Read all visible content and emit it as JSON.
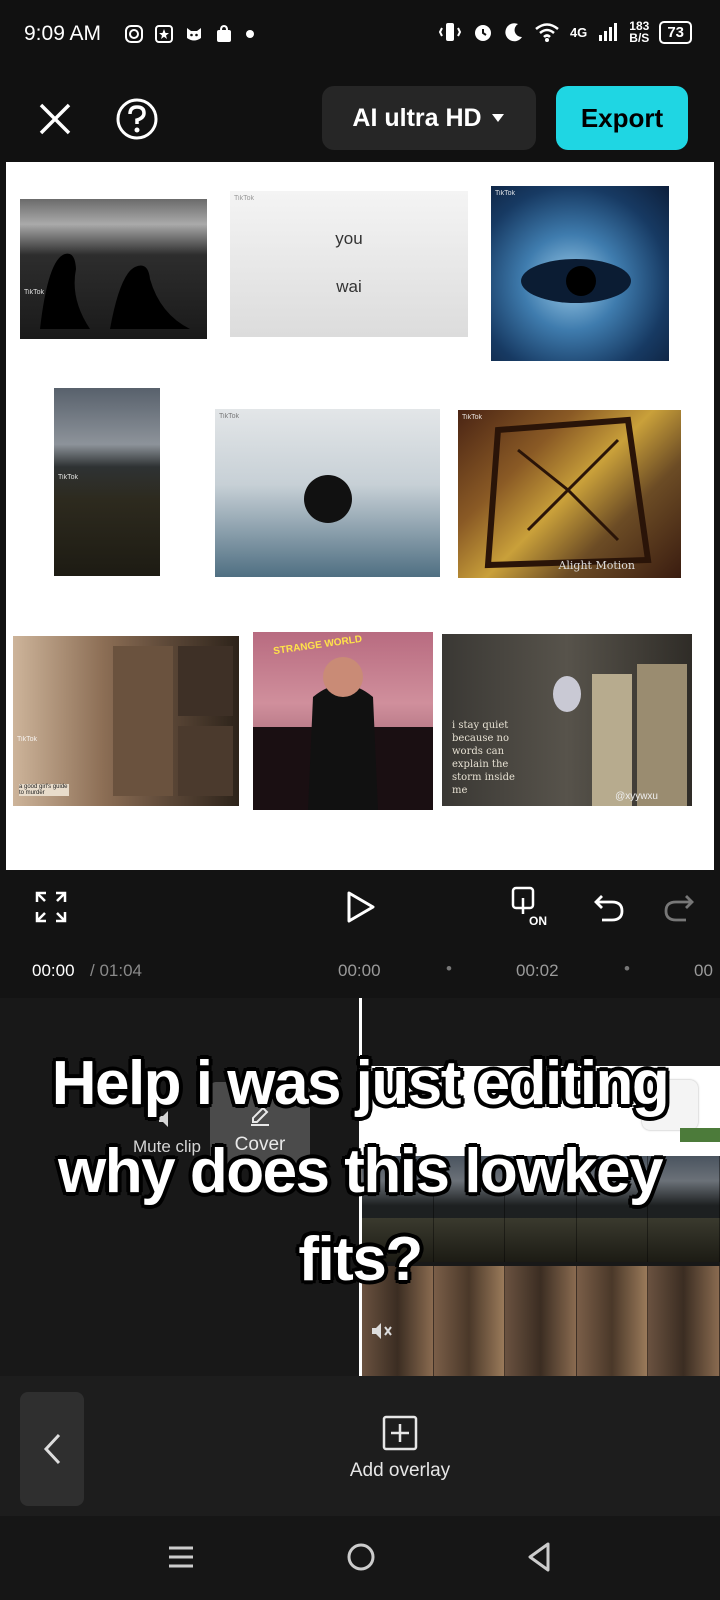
{
  "status_bar": {
    "time": "9:09 AM",
    "network": "4G",
    "speed_value": "183",
    "speed_unit": "B/S",
    "battery": "73"
  },
  "toolbar": {
    "quality_label": "AI ultra HD",
    "export_label": "Export"
  },
  "canvas": {
    "tile_text_you": "you",
    "tile_text_wai": "wai",
    "alight_motion": "Alight Motion",
    "goodgirls_text": "a good girl's guide to murder",
    "strange_world": "STRANGE WORLD",
    "quote_text": "i stay quiet because no words can explain the storm inside me",
    "watermark": "@xyywxu",
    "tiktok": "TikTok"
  },
  "playback": {
    "current_time": "00:00",
    "total_time": "/ 01:04"
  },
  "ruler": {
    "tick_0": "00:00",
    "tick_2": "00:02",
    "tick_4": "00"
  },
  "timeline": {
    "mute_label": "Mute clip",
    "cover_label": "Cover"
  },
  "caption": {
    "line1": "Help i was just editing",
    "line2": "why does this lowkey",
    "line3": "fits?"
  },
  "bottom": {
    "add_overlay_label": "Add overlay"
  },
  "colors": {
    "accent": "#1fd6e3",
    "background": "#121212"
  }
}
